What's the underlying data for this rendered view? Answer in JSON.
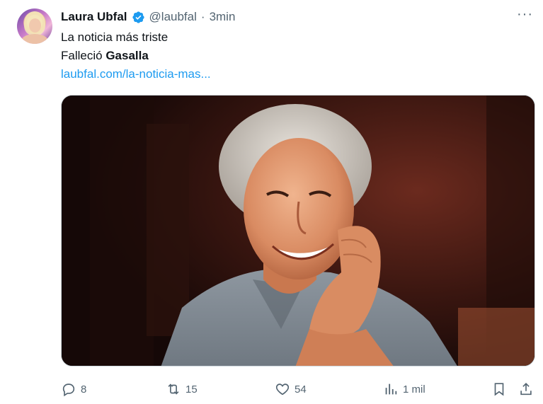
{
  "tweet": {
    "author_name": "Laura Ubfal",
    "handle": "@laubfal",
    "separator": "·",
    "time": "3min",
    "more_label": "···",
    "line1": "La noticia más triste",
    "line2_prefix": "Falleció ",
    "line2_strong": "Gasalla",
    "link": "laubfal.com/la-noticia-mas..."
  },
  "actions": {
    "replies": "8",
    "retweets": "15",
    "likes": "54",
    "views": "1 mil"
  },
  "colors": {
    "text": "#0f1419",
    "secondary": "#536471",
    "link": "#1d9bf0",
    "verified": "#1d9bf0"
  },
  "icons": [
    "verified-badge-icon",
    "more-icon",
    "reply-icon",
    "retweet-icon",
    "like-icon",
    "views-icon",
    "bookmark-icon",
    "share-icon"
  ]
}
